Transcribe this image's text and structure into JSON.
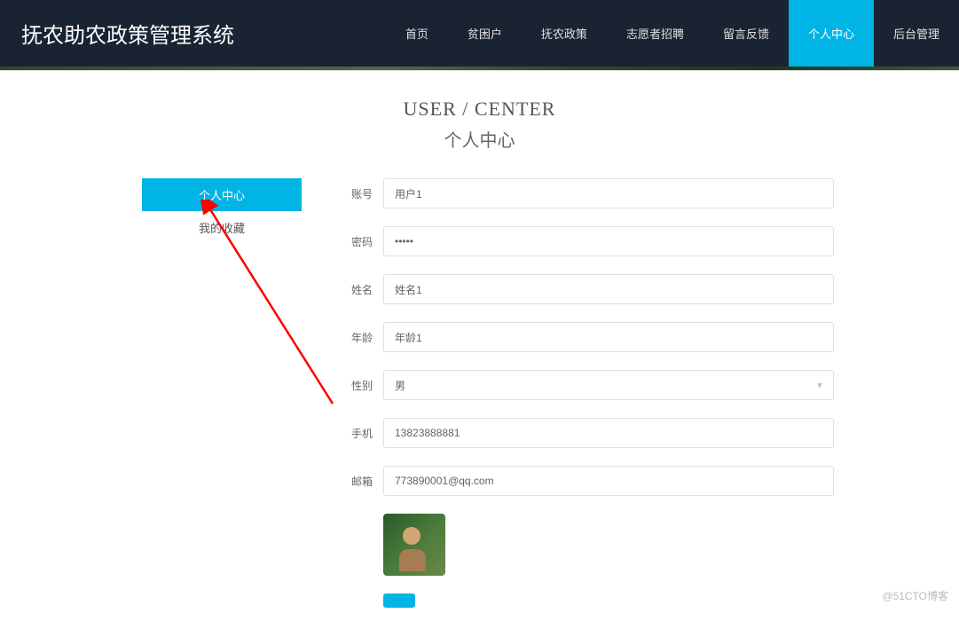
{
  "brand": "抚农助农政策管理系统",
  "nav": [
    {
      "label": "首页"
    },
    {
      "label": "贫困户"
    },
    {
      "label": "抚农政策"
    },
    {
      "label": "志愿者招聘"
    },
    {
      "label": "留言反馈"
    },
    {
      "label": "个人中心",
      "active": true
    },
    {
      "label": "后台管理"
    }
  ],
  "page_title": {
    "en": "USER / CENTER",
    "cn": "个人中心"
  },
  "sidebar": [
    {
      "label": "个人中心",
      "active": true
    },
    {
      "label": "我的收藏"
    }
  ],
  "form": {
    "account": {
      "label": "账号",
      "value": "用户1"
    },
    "password": {
      "label": "密码",
      "value": "•••••"
    },
    "name": {
      "label": "姓名",
      "value": "姓名1"
    },
    "age": {
      "label": "年龄",
      "value": "年龄1"
    },
    "gender": {
      "label": "性别",
      "value": "男"
    },
    "phone": {
      "label": "手机",
      "value": "13823888881"
    },
    "email": {
      "label": "邮箱",
      "value": "773890001@qq.com"
    }
  },
  "watermark": "@51CTO博客"
}
